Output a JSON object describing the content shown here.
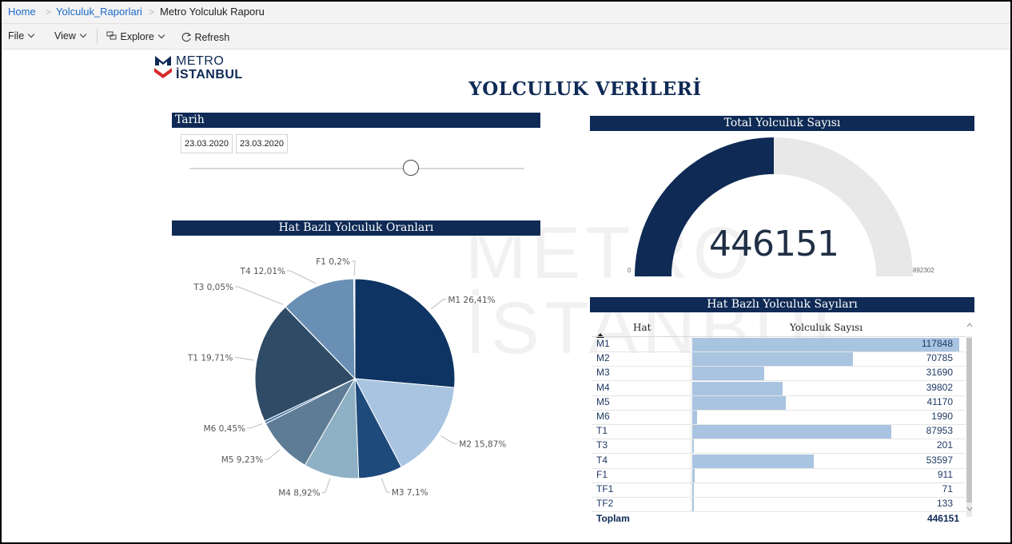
{
  "breadcrumb": {
    "home": "Home",
    "folder": "Yolculuk_Raporlari",
    "current": "Metro Yolculuk Raporu",
    "separator": ">"
  },
  "toolbar": {
    "file_label": "File",
    "view_label": "View",
    "explore_label": "Explore",
    "refresh_label": "Refresh"
  },
  "logo": {
    "line1": "METRO",
    "line2": "İSTANBUL"
  },
  "report_title": "YOLCULUK VERİLERİ",
  "date_filter": {
    "header": "Tarih",
    "start": "23.03.2020",
    "end": "23.03.2020",
    "slider_position_fraction": 0.66
  },
  "gauge": {
    "header": "Total Yolculuk Sayısı",
    "value": "446151",
    "min_label": "0",
    "max_label": "892302",
    "value_num": 446151,
    "max_num": 892302,
    "fill_color": "#0e2a55",
    "track_color": "#e8e8e8"
  },
  "pie": {
    "header": "Hat Bazlı Yolculuk Oranları"
  },
  "table": {
    "header": "Hat Bazlı Yolculuk Sayıları",
    "col_hat": "Hat",
    "col_count": "Yolculuk Sayısı",
    "max_value": 117848,
    "bar_color": "#a9c4e0",
    "rows": [
      {
        "hat": "M1",
        "count": "117848",
        "value": 117848
      },
      {
        "hat": "M2",
        "count": "70785",
        "value": 70785
      },
      {
        "hat": "M3",
        "count": "31690",
        "value": 31690
      },
      {
        "hat": "M4",
        "count": "39802",
        "value": 39802
      },
      {
        "hat": "M5",
        "count": "41170",
        "value": 41170
      },
      {
        "hat": "M6",
        "count": "1990",
        "value": 1990
      },
      {
        "hat": "T1",
        "count": "87953",
        "value": 87953
      },
      {
        "hat": "T3",
        "count": "201",
        "value": 201
      },
      {
        "hat": "T4",
        "count": "53597",
        "value": 53597
      },
      {
        "hat": "F1",
        "count": "911",
        "value": 911
      },
      {
        "hat": "TF1",
        "count": "71",
        "value": 71
      },
      {
        "hat": "TF2",
        "count": "133",
        "value": 133
      }
    ],
    "total_label": "Toplam",
    "total_value": "446151"
  },
  "chart_data": {
    "type": "pie",
    "title": "Hat Bazlı Yolculuk Oranları",
    "slices": [
      {
        "name": "M1",
        "percent": 26.41,
        "label": "M1 26,41%",
        "color": "#0e3464"
      },
      {
        "name": "M2",
        "percent": 15.87,
        "label": "M2 15,87%",
        "color": "#a9c4e0"
      },
      {
        "name": "M3",
        "percent": 7.1,
        "label": "M3 7,1%",
        "color": "#1f4a7c"
      },
      {
        "name": "M4",
        "percent": 8.92,
        "label": "M4 8,92%",
        "color": "#8eb0c4"
      },
      {
        "name": "M5",
        "percent": 9.23,
        "label": "M5 9,23%",
        "color": "#5f7c96"
      },
      {
        "name": "M6",
        "percent": 0.45,
        "label": "M6 0,45%",
        "color": "#4a78a8"
      },
      {
        "name": "T1",
        "percent": 19.71,
        "label": "T1 19,71%",
        "color": "#2f4b65"
      },
      {
        "name": "T3",
        "percent": 0.05,
        "label": "T3 0,05%",
        "color": "#3b5b7f"
      },
      {
        "name": "T4",
        "percent": 12.01,
        "label": "T4 12,01%",
        "color": "#6a8fb4"
      },
      {
        "name": "F1",
        "percent": 0.2,
        "label": "F1 0,2%",
        "color": "#c9d8e8"
      }
    ]
  }
}
